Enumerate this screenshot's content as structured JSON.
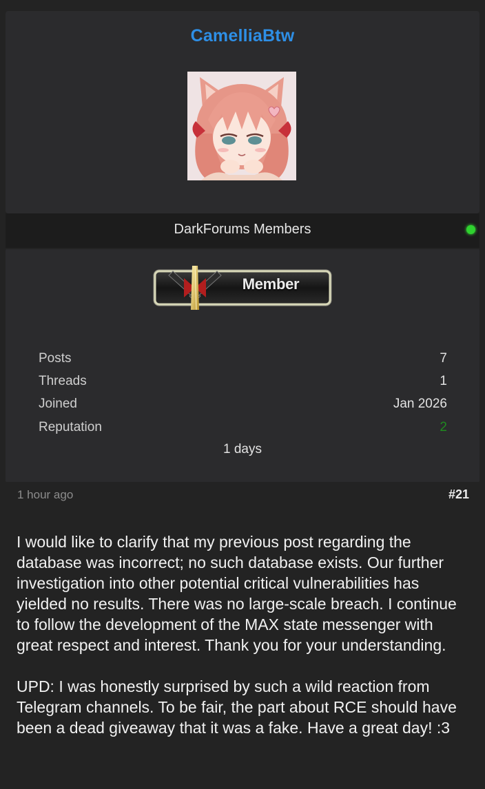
{
  "profile": {
    "username": "CamelliaBtw",
    "group": "DarkForums Members",
    "rank_badge": "Member",
    "online_status_color": "#2fd22f"
  },
  "stats": [
    {
      "label": "Posts",
      "value": "7"
    },
    {
      "label": "Threads",
      "value": "1"
    },
    {
      "label": "Joined",
      "value": "Jan 2026"
    },
    {
      "label": "Reputation",
      "value": "2"
    }
  ],
  "membership_duration": "1 days",
  "post": {
    "time": "1 hour ago",
    "number": "#21",
    "paragraphs": [
      "I would like to clarify that my previous post regarding the database was incorrect; no such database exists. Our further investigation into other potential critical vulnerabilities has yielded no results. There was no large-scale breach. I continue to follow the development of the MAX state messenger with great respect and interest. Thank you for your understanding.",
      "UPD: I was honestly surprised by such a wild reaction from Telegram channels. To be fair, the part about RCE should have been a dead giveaway that it was a fake. Have a great day! :3"
    ]
  },
  "colors": {
    "username": "#2e8fe6",
    "reputation": "#1f8a1f",
    "background": "#232323"
  }
}
